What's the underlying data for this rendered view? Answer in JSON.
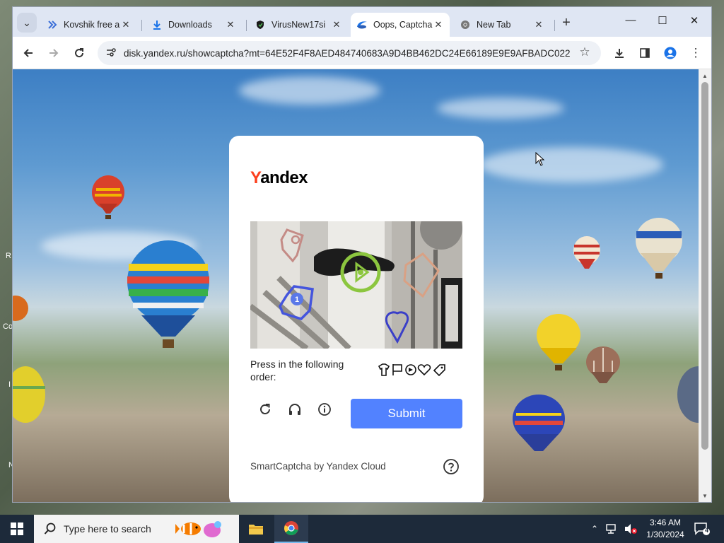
{
  "desktop": {
    "fragments": [
      "R",
      "Co",
      "I",
      "N"
    ]
  },
  "browser": {
    "tabs": [
      {
        "title": "Kovshik free a",
        "icon": "double-chevron-icon",
        "active": false
      },
      {
        "title": "Downloads",
        "icon": "download-icon",
        "active": false
      },
      {
        "title": "VirusNew17si",
        "icon": "shield-icon",
        "active": false
      },
      {
        "title": "Oops, Captcha",
        "icon": "yandex-disk-icon",
        "active": true
      },
      {
        "title": "New Tab",
        "icon": "chrome-icon",
        "active": false
      }
    ],
    "new_tab_label": "+",
    "address": {
      "url": "disk.yandex.ru/showcaptcha?mt=64E52F4F8AED484740683A9D4BB462DC24E66189E9E9AFBADC022..."
    }
  },
  "captcha": {
    "brand": {
      "first": "Y",
      "rest": "andex"
    },
    "prompt": "Press in the following order:",
    "order_icons": [
      "shirt-icon",
      "flag-icon",
      "circle-dot-icon",
      "heart-icon",
      "tag-icon"
    ],
    "badge_number": "1",
    "submit_label": "Submit",
    "footer": "SmartCaptcha by Yandex Cloud",
    "colors": {
      "accent": "#5282ff",
      "brand_red": "#fc3f1d"
    }
  },
  "taskbar": {
    "search_placeholder": "Type here to search",
    "time": "3:46 AM",
    "date": "1/30/2024",
    "notification_count": "4"
  }
}
